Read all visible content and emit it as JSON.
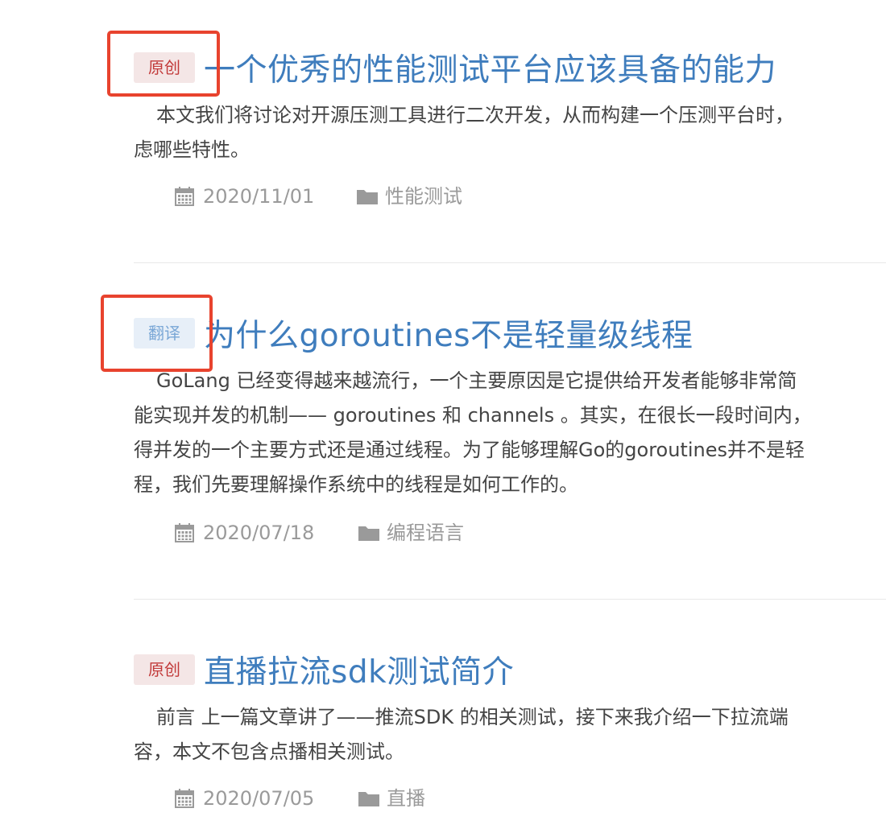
{
  "posts": [
    {
      "badge": "原创",
      "badge_type": "original",
      "title": "一个优秀的性能测试平台应该具备的能力",
      "excerpt_lines": [
        "本文我们将讨论对开源压测工具进行二次开发，从而构建一个压测平台时，",
        "虑哪些特性。"
      ],
      "date": "2020/11/01",
      "category": "性能测试"
    },
    {
      "badge": "翻译",
      "badge_type": "translated",
      "title": "为什么goroutines不是轻量级线程",
      "excerpt_lines": [
        "GoLang 已经变得越来越流行，一个主要原因是它提供给开发者能够非常简",
        "能实现并发的机制—— goroutines 和 channels 。其实，在很长一段时间内，",
        "得并发的一个主要方式还是通过线程。为了能够理解Go的goroutines并不是轻",
        "程，我们先要理解操作系统中的线程是如何工作的。"
      ],
      "date": "2020/07/18",
      "category": "编程语言"
    },
    {
      "badge": "原创",
      "badge_type": "original",
      "title": "直播拉流sdk测试简介",
      "excerpt_lines": [
        "前言 上一篇文章讲了——推流SDK 的相关测试，接下来我介绍一下拉流端",
        "容，本文不包含点播相关测试。"
      ],
      "date": "2020/07/05",
      "category": "直播"
    }
  ],
  "icons": {
    "date": "calendar-icon",
    "category": "folder-icon"
  },
  "colors": {
    "title": "#3f7dbd",
    "badge_original_bg": "#f4e6e6",
    "badge_original_text": "#c23a3a",
    "badge_translated_bg": "#e7eff8",
    "badge_translated_text": "#7aa7d6",
    "meta_text": "#9a9a9a",
    "highlight": "#e8432e"
  }
}
